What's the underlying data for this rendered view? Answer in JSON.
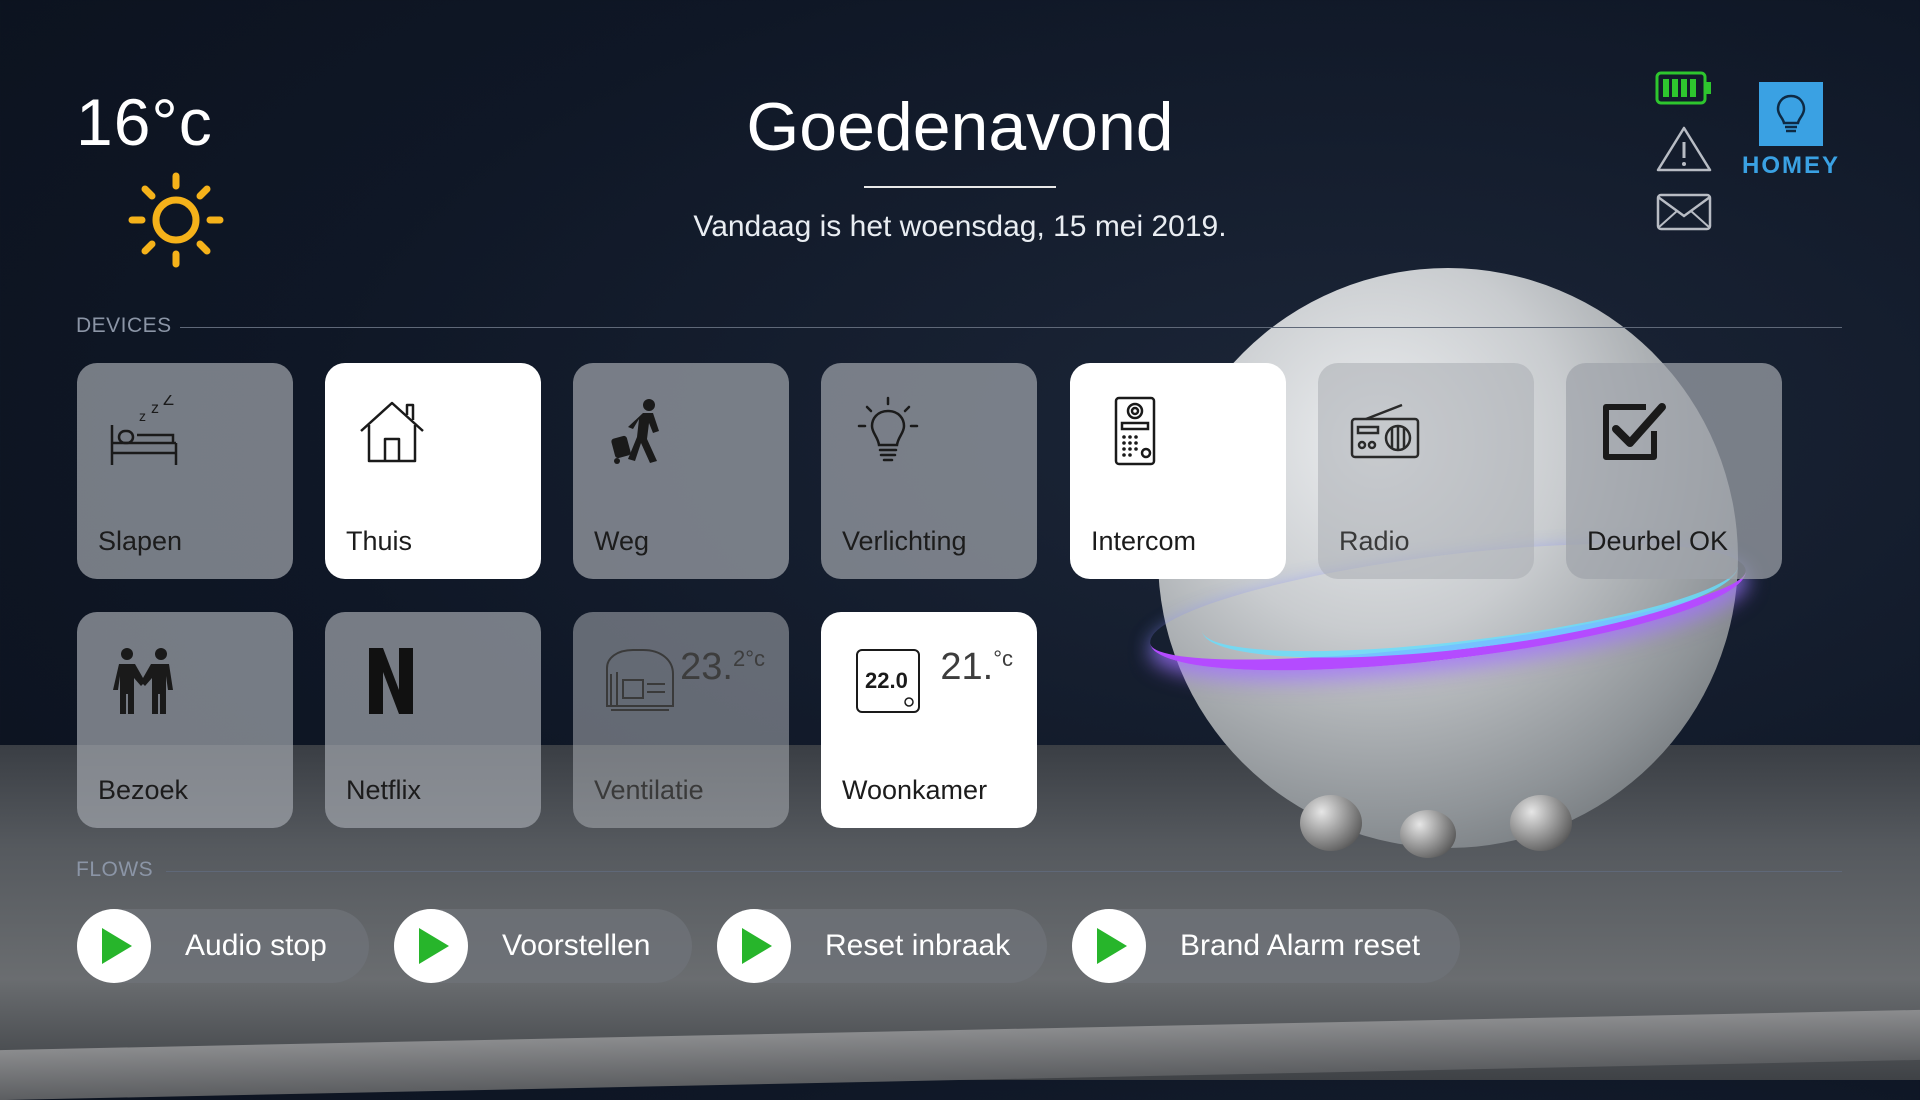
{
  "weather": {
    "temperature": "16°c",
    "icon": "sun-icon",
    "icon_color": "#f5b21a"
  },
  "header": {
    "greeting": "Goedenavond",
    "date_text": "Vandaag is het woensdag, 15 mei 2019."
  },
  "status": {
    "battery_icon": "battery-icon",
    "battery_color": "#2ec62e",
    "warning_icon": "warning-icon",
    "mail_icon": "mail-icon"
  },
  "brand": {
    "name": "HOMEY",
    "color": "#3aa1e3"
  },
  "devices": {
    "section_label": "DEVICES",
    "tiles": [
      {
        "label": "Slapen",
        "icon": "bed-sleep-icon",
        "state": "off"
      },
      {
        "label": "Thuis",
        "icon": "house-icon",
        "state": "on"
      },
      {
        "label": "Weg",
        "icon": "traveler-icon",
        "state": "off"
      },
      {
        "label": "Verlichting",
        "icon": "lightbulb-icon",
        "state": "off"
      },
      {
        "label": "Intercom",
        "icon": "intercom-icon",
        "state": "on"
      },
      {
        "label": "Radio",
        "icon": "radio-icon",
        "state": "dim"
      },
      {
        "label": "Deurbel OK",
        "icon": "checkbox-icon",
        "state": "off"
      },
      {
        "label": "Bezoek",
        "icon": "visitors-icon",
        "state": "off"
      },
      {
        "label": "Netflix",
        "icon": "netflix-icon",
        "state": "off"
      },
      {
        "label": "Ventilatie",
        "icon": "ventilation-unit-icon",
        "state": "dim",
        "reading": "23.",
        "reading_unit": "2°c"
      },
      {
        "label": "Woonkamer",
        "icon": "thermostat-icon",
        "state": "on",
        "reading": "21.",
        "reading_unit": "°c",
        "thermostat_display": "22.0"
      }
    ]
  },
  "flows": {
    "section_label": "FLOWS",
    "items": [
      {
        "label": "Audio stop",
        "icon": "play-icon",
        "color": "#27b52b"
      },
      {
        "label": "Voorstellen",
        "icon": "play-icon",
        "color": "#27b52b"
      },
      {
        "label": "Reset inbraak",
        "icon": "play-icon",
        "color": "#27b52b"
      },
      {
        "label": "Brand Alarm reset",
        "icon": "play-icon",
        "color": "#27b52b"
      }
    ]
  }
}
